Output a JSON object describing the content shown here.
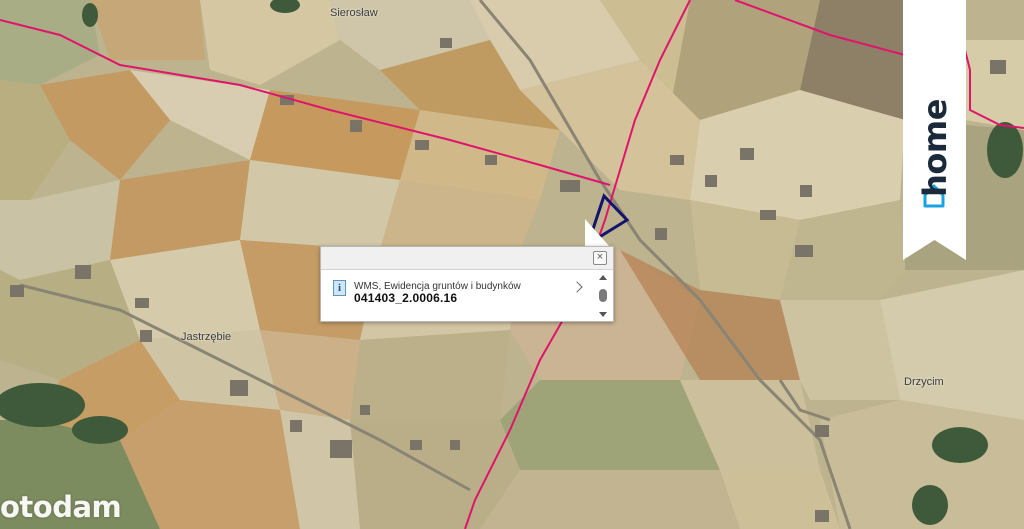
{
  "map": {
    "labels": {
      "sieroslaw": "Sierosław",
      "jastrzebie": "Jastrzębie",
      "drzycim": "Drzycim"
    }
  },
  "popup": {
    "layer_name": "WMS, Ewidencja gruntów i budynków",
    "parcel_id": "041403_2.0006.16",
    "close_symbol": "×",
    "info_symbol": "i"
  },
  "brand": {
    "badge_text": "home",
    "watermark": "otodam"
  },
  "colors": {
    "boundary": "#e0146a",
    "parcel_outline": "#14146e",
    "badge_bg": "#ffffff",
    "badge_accent": "#1aa3e0"
  }
}
